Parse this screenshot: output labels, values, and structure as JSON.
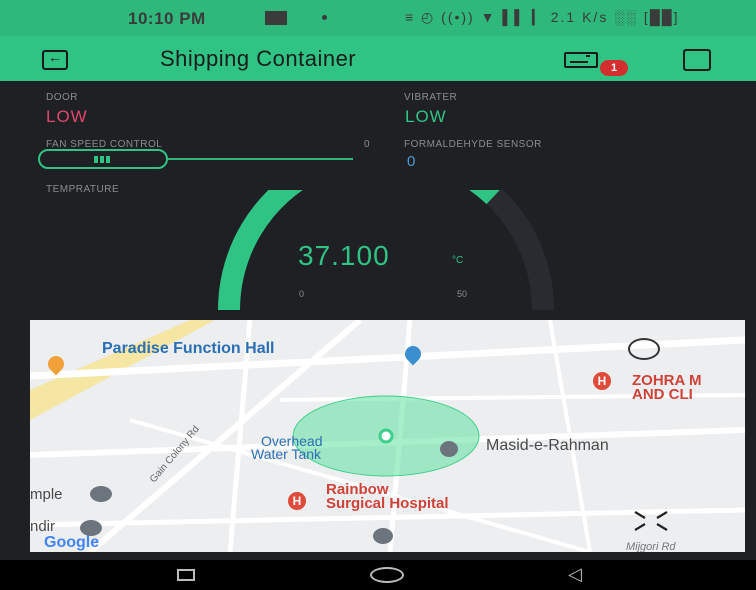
{
  "status_bar": {
    "time": "10:10 PM",
    "icons": "≡ ◴ ((•)) ▼ ▌▌ ▎ 2.1 K/s  ░░ [██]"
  },
  "header": {
    "title": "Shipping Container",
    "badge_count": "1",
    "icons": [
      "exit-icon",
      "device-icon",
      "square-icon"
    ]
  },
  "widgets": {
    "door": {
      "label": "DOOR",
      "value": "LOW"
    },
    "vibrater": {
      "label": "VIBRATER",
      "value": "LOW"
    },
    "fan": {
      "label": "FAN SPEED CONTROL",
      "value": "0",
      "level": 0
    },
    "formaldehyde": {
      "label": "FORMALDEHYDE SENSOR",
      "value": "0"
    },
    "temperature": {
      "label": "TEMPRATURE",
      "value": "37.100",
      "unit": "°C",
      "min": "0",
      "max": "50",
      "fraction": 0.742
    }
  },
  "map": {
    "places": {
      "paradise": "Paradise Function Hall",
      "zohra": "ZOHRA M",
      "zohra2": "AND CLI",
      "overhead": "Overhead",
      "overhead2": "Water Tank",
      "masid": "Masid-e-Rahman",
      "temple": "mple",
      "mandir": "ndir",
      "rainbow1": "Rainbow",
      "rainbow2": "Surgical Hospital",
      "colony": "Gain Colony Rd",
      "mijgori": "Mijgori Rd",
      "google": "Google"
    },
    "colors": {
      "accent": "#2fc384",
      "pin_red": "#e04a3a",
      "pin_blue": "#3a8fd0"
    }
  },
  "nav": {
    "icons": [
      "recent-apps-icon",
      "home-icon",
      "back-icon"
    ]
  }
}
